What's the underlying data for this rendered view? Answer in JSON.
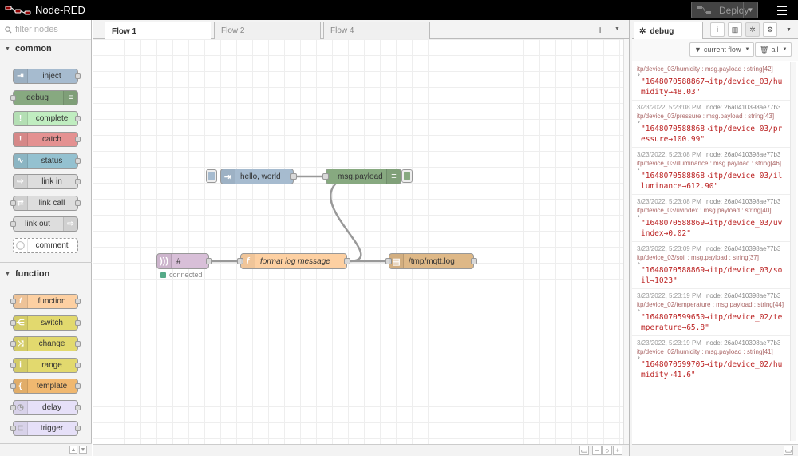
{
  "header": {
    "app_title": "Node-RED",
    "deploy_label": "Deploy",
    "colors": {
      "bar": "#000000",
      "deploy_bg": "#444444"
    }
  },
  "palette": {
    "search_placeholder": "filter nodes",
    "categories": [
      {
        "label": "common",
        "nodes": [
          {
            "label": "inject",
            "color": "#a6bbcf",
            "icon": "arrow-in-icon"
          },
          {
            "label": "debug",
            "color": "#87a980",
            "icon": "list-icon"
          },
          {
            "label": "complete",
            "color": "#c0edc0",
            "icon": "check-icon"
          },
          {
            "label": "catch",
            "color": "#e49191",
            "icon": "alert-icon"
          },
          {
            "label": "status",
            "color": "#94c1d0",
            "icon": "pulse-icon"
          },
          {
            "label": "link in",
            "color": "#dddddd",
            "icon": "link-in-icon"
          },
          {
            "label": "link call",
            "color": "#dddddd",
            "icon": "link-call-icon"
          },
          {
            "label": "link out",
            "color": "#dddddd",
            "icon": "link-out-icon"
          },
          {
            "label": "comment",
            "color": "#ffffff",
            "icon": "comment-icon"
          }
        ]
      },
      {
        "label": "function",
        "nodes": [
          {
            "label": "function",
            "color": "#fdd0a2",
            "icon": "function-icon"
          },
          {
            "label": "switch",
            "color": "#e2d96e",
            "icon": "switch-icon"
          },
          {
            "label": "change",
            "color": "#e2d96e",
            "icon": "shuffle-icon"
          },
          {
            "label": "range",
            "color": "#e2d96e",
            "icon": "range-icon"
          },
          {
            "label": "template",
            "color": "#f0b870",
            "icon": "braces-icon"
          },
          {
            "label": "delay",
            "color": "#e6e0f8",
            "icon": "timer-icon"
          },
          {
            "label": "trigger",
            "color": "#e6e0f8",
            "icon": "trigger-icon"
          }
        ]
      }
    ]
  },
  "workspace": {
    "tabs": [
      {
        "label": "Flow 1",
        "active": true
      },
      {
        "label": "Flow 2",
        "active": false
      },
      {
        "label": "Flow 4",
        "active": false
      }
    ],
    "nodes": {
      "inject": {
        "label": "hello, world",
        "color": "#a6bbcf"
      },
      "debug": {
        "label": "msg.payload",
        "color": "#87a980"
      },
      "mqtt": {
        "label": "#",
        "color": "#d8bfd8"
      },
      "function": {
        "label": "format log message",
        "color": "#fdd0a2"
      },
      "file": {
        "label": "/tmp/mqtt.log",
        "color": "#deb887"
      }
    },
    "mqtt_status": "connected"
  },
  "sidebar": {
    "tab_label": "debug",
    "filter_label": "current flow",
    "clear_label": "all",
    "messages": [
      {
        "timestamp": "",
        "node": "",
        "topic": "itp/device_03/humidity : msg.payload : string[42]",
        "value": "\"1648070588867→itp/device_03/humidity→48.03\""
      },
      {
        "timestamp": "3/23/2022, 5:23:08 PM",
        "node": "node: 26a0410398ae77b3",
        "topic": "itp/device_03/pressure : msg.payload : string[43]",
        "value": "\"1648070588868→itp/device_03/pressure→100.99\""
      },
      {
        "timestamp": "3/23/2022, 5:23:08 PM",
        "node": "node: 26a0410398ae77b3",
        "topic": "itp/device_03/illuminance : msg.payload : string[46]",
        "value": "\"1648070588868→itp/device_03/illuminance→612.90\""
      },
      {
        "timestamp": "3/23/2022, 5:23:08 PM",
        "node": "node: 26a0410398ae77b3",
        "topic": "itp/device_03/uvindex : msg.payload : string[40]",
        "value": "\"1648070588869→itp/device_03/uvindex→0.02\""
      },
      {
        "timestamp": "3/23/2022, 5:23:09 PM",
        "node": "node: 26a0410398ae77b3",
        "topic": "itp/device_03/soil : msg.payload : string[37]",
        "value": "\"1648070588869→itp/device_03/soil→1023\""
      },
      {
        "timestamp": "3/23/2022, 5:23:19 PM",
        "node": "node: 26a0410398ae77b3",
        "topic": "itp/device_02/temperature : msg.payload : string[44]",
        "value": "\"1648070599650→itp/device_02/temperature→65.8\""
      },
      {
        "timestamp": "3/23/2022, 5:23:19 PM",
        "node": "node: 26a0410398ae77b3",
        "topic": "itp/device_02/humidity : msg.payload : string[41]",
        "value": "\"1648070599705→itp/device_02/humidity→41.6\""
      }
    ]
  }
}
